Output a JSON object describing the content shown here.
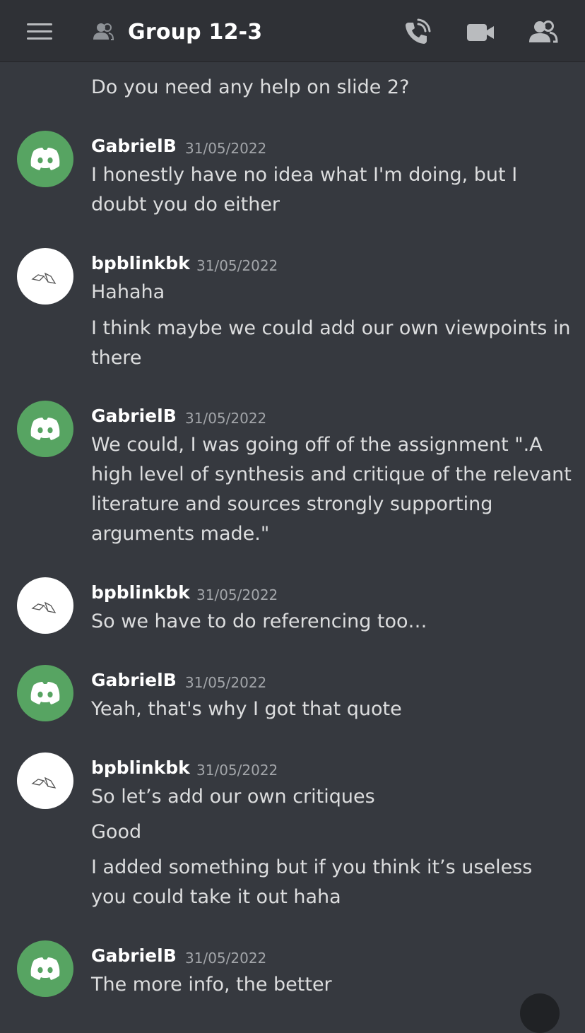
{
  "header": {
    "title": "Group 12-3"
  },
  "icons": {
    "menu": "hamburger-icon",
    "group": "group-icon",
    "call": "phone-call-icon",
    "video": "video-camera-icon",
    "members": "members-icon"
  },
  "colors": {
    "background": "#36393f",
    "topbar": "#2f3136",
    "avatar_green": "#57a462",
    "timestamp": "#a3a6aa",
    "text": "#dcddde"
  },
  "messages": {
    "m0": {
      "text": "Do you need any help on slide 2?"
    },
    "m1": {
      "author": "GabrielB",
      "timestamp": "31/05/2022",
      "lines": [
        "I honestly have no idea what I'm doing, but I doubt you do either"
      ]
    },
    "m2": {
      "author": "bpblinkbk",
      "timestamp": "31/05/2022",
      "lines": [
        "Hahaha",
        "I think maybe we could add our own viewpoints in there"
      ]
    },
    "m3": {
      "author": "GabrielB",
      "timestamp": "31/05/2022",
      "lines": [
        "We could, I was going off of the assignment \".A high level of synthesis and critique of the relevant literature and sources strongly supporting arguments made.\""
      ]
    },
    "m4": {
      "author": "bpblinkbk",
      "timestamp": "31/05/2022",
      "lines": [
        "So we have to do referencing too…"
      ]
    },
    "m5": {
      "author": "GabrielB",
      "timestamp": "31/05/2022",
      "lines": [
        "Yeah, that's why I got that quote"
      ]
    },
    "m6": {
      "author": "bpblinkbk",
      "timestamp": "31/05/2022",
      "lines": [
        "So let’s add our own critiques",
        "Good",
        "I added something but if you think it’s useless you could take it out haha"
      ]
    },
    "m7": {
      "author": "GabrielB",
      "timestamp": "31/05/2022",
      "lines": [
        "The more info, the better"
      ]
    }
  }
}
